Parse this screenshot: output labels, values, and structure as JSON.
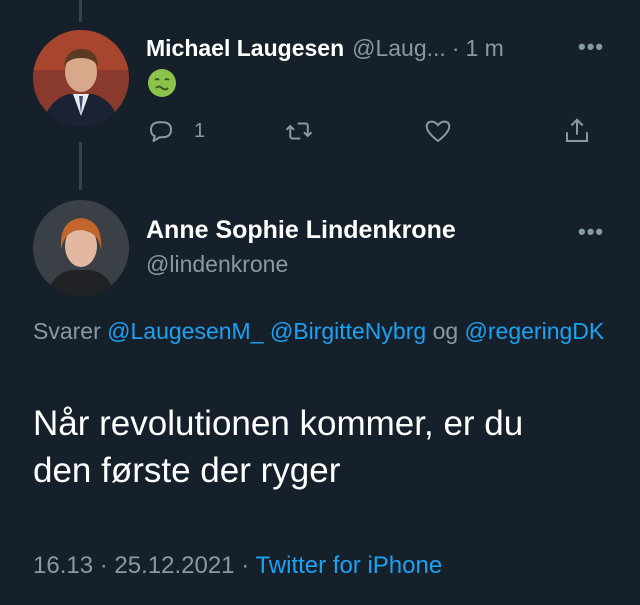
{
  "tweet1": {
    "name": "Michael Laugesen",
    "handle": "@Laug...",
    "separator": "·",
    "time": "1 m",
    "emoji": "nauseated-face",
    "reply_count": "1"
  },
  "tweet2": {
    "name": "Anne Sophie Lindenkrone",
    "handle": "@lindenkrone",
    "reply_prefix": "Svarer",
    "mentions": [
      "@LaugesenM_",
      "@BirgitteNybrg",
      "@regeringDK"
    ],
    "mention_joiner": "og",
    "text_line1": "Når revolutionen kommer, er du",
    "text_line2": "den første der ryger",
    "time": "16.13",
    "date": "25.12.2021",
    "meta_sep": "·",
    "source": "Twitter for iPhone"
  },
  "colors": {
    "background": "#15202b",
    "muted": "#8899a6",
    "accent": "#1da1f2",
    "thread_line": "#38444d"
  },
  "icons": [
    "reply-icon",
    "retweet-icon",
    "like-icon",
    "share-icon",
    "more-icon"
  ]
}
